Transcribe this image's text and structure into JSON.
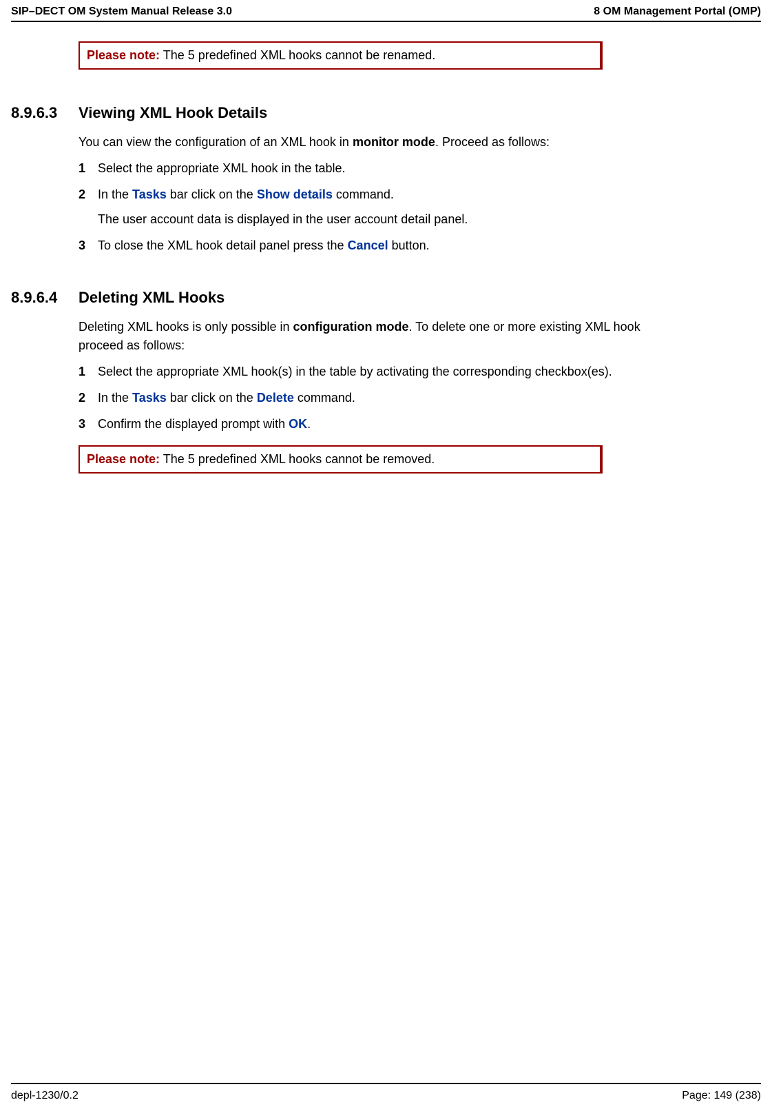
{
  "header": {
    "left": "SIP–DECT OM System Manual Release 3.0",
    "right": "8 OM Management Portal (OMP)"
  },
  "note1": {
    "label": "Please note:",
    "text": "The 5 predefined XML hooks cannot be renamed."
  },
  "section893": {
    "number": "8.9.6.3",
    "title": "Viewing XML Hook Details",
    "intro1": "You can view the configuration of an XML hook in ",
    "intro_bold": "monitor mode",
    "intro2": ". Proceed as follows:",
    "step1": "Select the appropriate XML hook in the table.",
    "step2_a": "In the ",
    "step2_tasks": "Tasks",
    "step2_b": " bar click on the ",
    "step2_show": "Show details",
    "step2_c": " command.",
    "step2_sub": "The user account data is displayed in the user account detail panel.",
    "step3_a": "To close the XML hook detail panel press the ",
    "step3_cancel": "Cancel",
    "step3_b": " button."
  },
  "section894": {
    "number": "8.9.6.4",
    "title": "Deleting XML Hooks",
    "intro1": "Deleting XML hooks is only possible in ",
    "intro_bold": "configuration mode",
    "intro2": ". To delete one or more existing XML hook proceed as follows:",
    "step1": "Select the appropriate XML hook(s) in the table by activating the corresponding checkbox(es).",
    "step2_a": "In the ",
    "step2_tasks": "Tasks",
    "step2_b": " bar click on the ",
    "step2_delete": "Delete",
    "step2_c": " command.",
    "step3_a": "Confirm the displayed prompt with ",
    "step3_ok": "OK",
    "step3_b": "."
  },
  "note2": {
    "label": "Please note:",
    "text": "The 5 predefined XML hooks cannot be removed."
  },
  "footer": {
    "left": "depl-1230/0.2",
    "right": "Page: 149 (238)"
  }
}
